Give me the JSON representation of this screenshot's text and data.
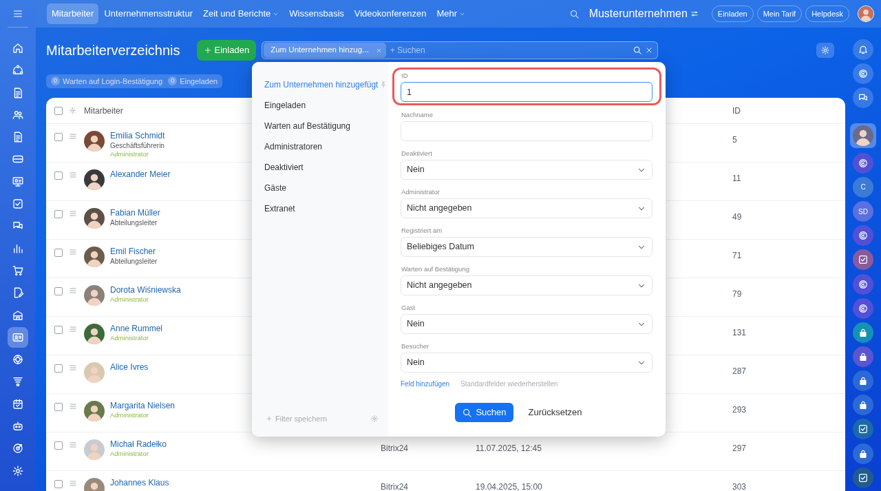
{
  "top_bar": {
    "menu": [
      {
        "label": "Mitarbeiter",
        "selected": true,
        "dropdown": false
      },
      {
        "label": "Unternehmensstruktur",
        "selected": false,
        "dropdown": false
      },
      {
        "label": "Zeit und Berichte",
        "selected": false,
        "dropdown": true
      },
      {
        "label": "Wissensbasis",
        "selected": false,
        "dropdown": false
      },
      {
        "label": "Videokonferenzen",
        "selected": false,
        "dropdown": false
      },
      {
        "label": "Mehr",
        "selected": false,
        "dropdown": true
      }
    ],
    "company": "Musterunternehmen",
    "buttons": [
      "Einladen",
      "Mein Tarif",
      "Helpdesk"
    ]
  },
  "left_sidebar": {
    "items": [
      {
        "selected": false
      },
      {
        "selected": false
      },
      {
        "selected": false
      },
      {
        "selected": false
      },
      {
        "selected": false
      },
      {
        "selected": false
      },
      {
        "selected": false
      },
      {
        "selected": false
      },
      {
        "selected": false
      },
      {
        "selected": false
      },
      {
        "selected": false
      },
      {
        "selected": false
      },
      {
        "selected": false
      },
      {
        "selected": true
      },
      {
        "selected": false
      },
      {
        "selected": false
      },
      {
        "selected": false
      },
      {
        "selected": false
      },
      {
        "selected": false
      },
      {
        "selected": false
      }
    ]
  },
  "header": {
    "title": "Mitarbeiterverzeichnis",
    "invite_button": "Einladen",
    "search": {
      "tag": "Zum Unternehmen hinzug...",
      "placeholder": "+ Suchen"
    },
    "counters": [
      {
        "count": "0",
        "label": "Warten auf Login-Bestätigung"
      },
      {
        "count": "0",
        "label": "Eingeladen"
      }
    ]
  },
  "table": {
    "select_all_checked": false,
    "columns": [
      {
        "label": "Mitarbeiter"
      },
      {
        "label": "ID"
      }
    ],
    "rows": [
      {
        "name": "Emilia Schmidt",
        "position": "Geschäftsführerin",
        "role": "Administrator",
        "id": "5",
        "checked": false
      },
      {
        "name": "Alexander Meier",
        "id": "11",
        "checked": false
      },
      {
        "name": "Fabian Müller",
        "position": "Abteilungsleiter",
        "id": "49",
        "checked": false
      },
      {
        "name": "Emil Fischer",
        "position": "Abteilungsleiter",
        "id": "71",
        "checked": false
      },
      {
        "name": "Dorota Wiśniewska",
        "role": "Administrator",
        "id": "79",
        "checked": false
      },
      {
        "name": "Anne Rummel",
        "role": "Administrator",
        "id": "131",
        "checked": false
      },
      {
        "name": "Alice Ivres",
        "id": "287",
        "checked": false
      },
      {
        "name": "Margarita Nielsen",
        "role": "Administrator",
        "id": "293",
        "checked": false
      },
      {
        "name": "Michał Radełko",
        "role": "Administrator",
        "column_3": "Bitrix24",
        "column_4": "11.07.2025, 12:45",
        "id": "297",
        "checked": false
      },
      {
        "name": "Johannes Klaus",
        "column_3": "Bitrix24",
        "column_4": "19.04.2025, 15:00",
        "id": "303",
        "checked": false
      }
    ]
  },
  "filter_popup": {
    "presets": [
      {
        "label": "Zum Unternehmen hinzugefügt",
        "selected": true,
        "pinned": true
      },
      {
        "label": "Eingeladen",
        "selected": false,
        "pinned": false
      },
      {
        "label": "Warten auf Bestätigung",
        "selected": false,
        "pinned": false
      },
      {
        "label": "Administratoren",
        "selected": false,
        "pinned": false
      },
      {
        "label": "Deaktiviert",
        "selected": false,
        "pinned": false
      },
      {
        "label": "Gäste",
        "selected": false,
        "pinned": false
      },
      {
        "label": "Extranet",
        "selected": false,
        "pinned": false
      }
    ],
    "save_filter": "Filter speichern",
    "fields": [
      {
        "label": "ID",
        "kind": "input",
        "value": "1",
        "focused": true,
        "highlighted": true
      },
      {
        "label": "Nachname",
        "kind": "input",
        "focused": false,
        "highlighted": false
      },
      {
        "label": "Deaktiviert",
        "kind": "select",
        "value": "Nein",
        "focused": false,
        "highlighted": false
      },
      {
        "label": "Administrator",
        "kind": "select",
        "value": "Nicht angegeben",
        "focused": false,
        "highlighted": false
      },
      {
        "label": "Registriert am",
        "kind": "select",
        "value": "Beliebiges Datum",
        "focused": false,
        "highlighted": false
      },
      {
        "label": "Warten auf Bestätigung",
        "kind": "select",
        "value": "Nicht angegeben",
        "focused": false,
        "highlighted": false
      },
      {
        "label": "Gast",
        "kind": "select",
        "value": "Nein",
        "focused": false,
        "highlighted": false
      },
      {
        "label": "Besucher",
        "kind": "select",
        "value": "Nein",
        "focused": false,
        "highlighted": false
      }
    ],
    "add_field": "Feld hinzufügen",
    "reset_fields": "Standardfelder wiederherstellen",
    "search_button": "Suchen",
    "reset_button": "Zurücksetzen"
  },
  "right_sidebar": {
    "items": [
      {
        "kind": "bell",
        "selected": false
      },
      {
        "kind": "ring",
        "selected": false
      },
      {
        "kind": "chat",
        "selected": false
      },
      {
        "kind": "avatar",
        "selected": true
      },
      {
        "kind": "swirl",
        "color": "#5350d8",
        "selected": false
      },
      {
        "kind": "letter",
        "text": "C",
        "color": "#3a7bd5",
        "selected": false
      },
      {
        "kind": "letter",
        "text": "SD",
        "color": "#5a6fe0",
        "selected": false
      },
      {
        "kind": "swirl",
        "color": "#5350d8",
        "selected": false
      },
      {
        "kind": "check",
        "color": "#8a5a9e",
        "selected": false
      },
      {
        "kind": "swirl",
        "color": "#5350d8",
        "selected": false
      },
      {
        "kind": "swirl",
        "color": "#5350d8",
        "selected": false
      },
      {
        "kind": "lock",
        "color": "#1591b5",
        "selected": false
      },
      {
        "kind": "lock",
        "color": "#5b55cf",
        "selected": false
      },
      {
        "kind": "lock",
        "color": "#2b6ad6",
        "selected": false
      },
      {
        "kind": "lock",
        "color": "#2b6ad6",
        "selected": false
      },
      {
        "kind": "check",
        "color": "#1b6aa8",
        "selected": false
      },
      {
        "kind": "lock",
        "color": "#2b6ad6",
        "selected": false
      },
      {
        "kind": "check",
        "color": "#215c8e",
        "selected": false
      }
    ]
  }
}
